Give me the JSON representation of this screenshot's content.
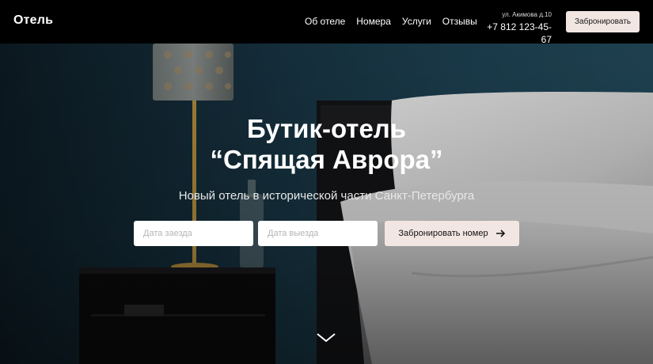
{
  "header": {
    "logo": "Отель",
    "nav": [
      "Об отеле",
      "Номера",
      "Услуги",
      "Отзывы"
    ],
    "address": "ул. Акимова д.10",
    "phone": "+7 812 123-45-67",
    "book_label": "Забронировать"
  },
  "hero": {
    "title_line1": "Бутик-отель",
    "title_line2": "“Спящая Аврора”",
    "subtitle": "Новый отель в исторической части Санкт-Петербурга",
    "checkin_placeholder": "Дата заезда",
    "checkout_placeholder": "Дата выезда",
    "book_room_label": "Забронировать номер",
    "arrow_icon": "arrow-right-icon",
    "scroll_icon": "chevron-down-icon"
  },
  "colors": {
    "accent": "#f2e6e2",
    "header_bg": "#000000"
  }
}
